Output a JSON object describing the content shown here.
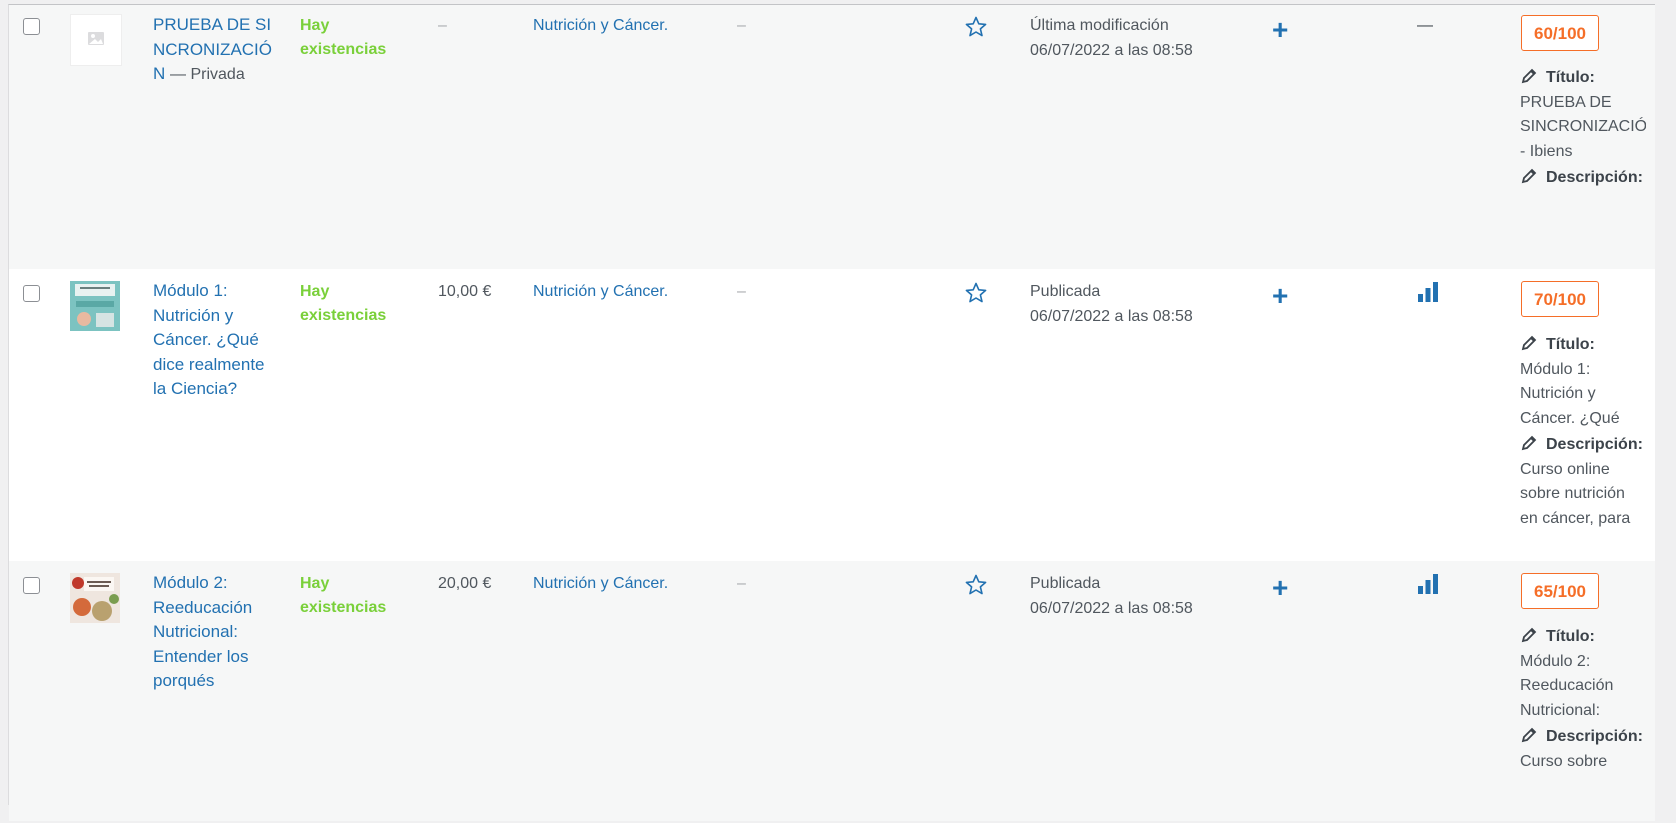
{
  "rows": [
    {
      "title": "PRUEBA DE SINCRONIZACIÓN",
      "private_label": "— Privada",
      "stock": "Hay existencias",
      "price": "–",
      "category": "Nutrición y Cáncer.",
      "tags": "–",
      "status_label": "Última modificación",
      "date": "06/07/2022 a las 08:58",
      "analytics": "—",
      "score": "60/100",
      "seo_title_label": "Título:",
      "seo_title_text": "PRUEBA DE SINCRONIZACIÓN - Ibiens",
      "seo_desc_label": "Descripción:",
      "seo_desc_text": ""
    },
    {
      "title": "Módulo 1: Nutrición y Cáncer. ¿Qué dice realmente la Ciencia?",
      "stock": "Hay existencias",
      "price": "10,00 €",
      "category": "Nutrición y Cáncer.",
      "tags": "–",
      "status_label": "Publicada",
      "date": "06/07/2022 a las 08:58",
      "score": "70/100",
      "seo_title_label": "Título:",
      "seo_title_text": "Módulo 1: Nutrición y Cáncer. ¿Qué",
      "seo_desc_label": "Descripción:",
      "seo_desc_text": "Curso online sobre nutrición en cáncer, para"
    },
    {
      "title": "Módulo 2: Reeducación Nutricional: Entender los porqués",
      "stock": "Hay existencias",
      "price": "20,00 €",
      "category": "Nutrición y Cáncer.",
      "tags": "–",
      "status_label": "Publicada",
      "date": "06/07/2022 a las 08:58",
      "score": "65/100",
      "seo_title_label": "Título:",
      "seo_title_text": "Módulo 2: Reeducación Nutricional:",
      "seo_desc_label": "Descripción:",
      "seo_desc_text": "Curso sobre"
    }
  ],
  "colors": {
    "link": "#2271b1",
    "stock": "#7ad03a",
    "score": "#f56e28"
  },
  "icons": [
    "star-outline-icon",
    "plus-icon",
    "bar-chart-icon",
    "pencil-icon",
    "placeholder-image-icon"
  ]
}
